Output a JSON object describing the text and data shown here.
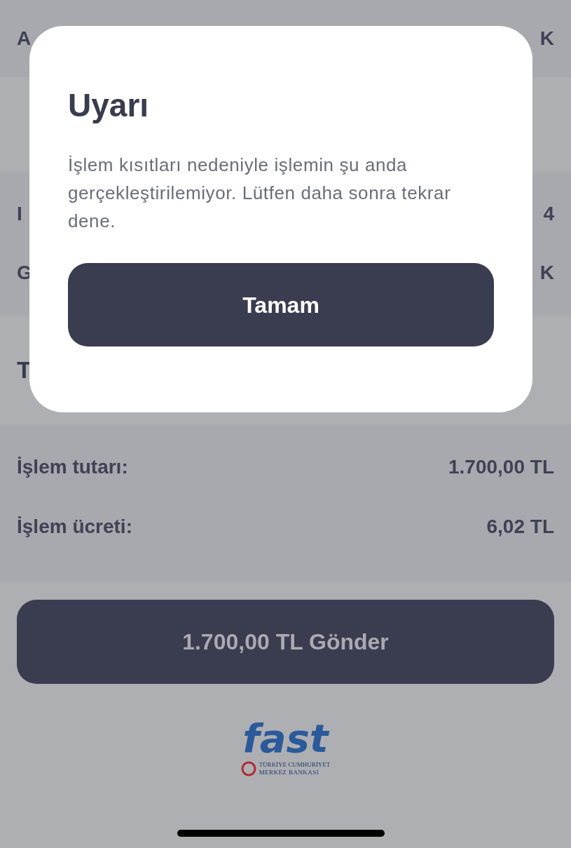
{
  "background": {
    "top_row": {
      "label": "A",
      "value": "K"
    },
    "middle_rows": [
      {
        "label": "I",
        "value": "4"
      },
      {
        "label": "G",
        "value": "K"
      }
    ],
    "section_title": "T",
    "amount_rows": [
      {
        "label": "İşlem tutarı:",
        "value": "1.700,00 TL"
      },
      {
        "label": "İşlem ücreti:",
        "value": "6,02 TL"
      }
    ],
    "send_button": "1.700,00 TL Gönder",
    "logo": {
      "wordmark": "fast",
      "issuer_line_1": "TÜRKİYE CUMHURİYET",
      "issuer_line_2": "MERKEZ BANKASI"
    }
  },
  "dialog": {
    "title": "Uyarı",
    "message": "İşlem kısıtları nedeniyle işlemin şu anda gerçekleştirilemiyor. Lütfen daha sonra tekrar dene.",
    "button": "Tamam"
  }
}
